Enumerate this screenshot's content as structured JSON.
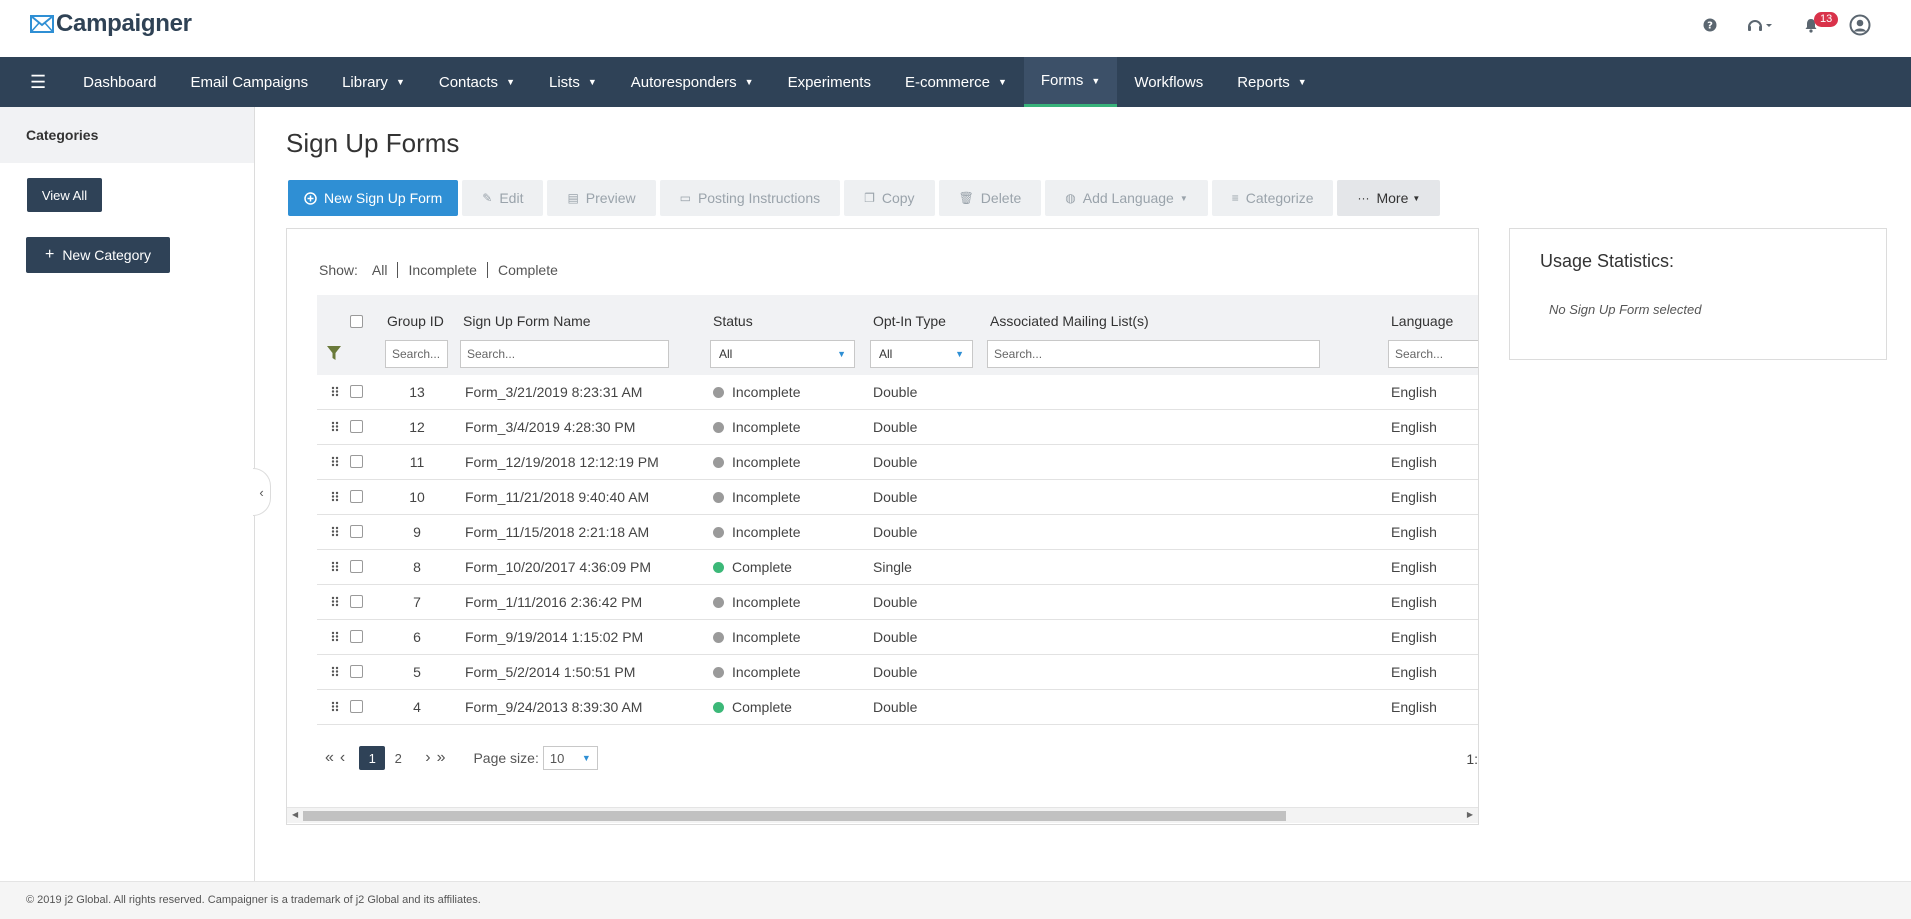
{
  "header": {
    "brand": "Campaigner",
    "notifications_count": "13"
  },
  "nav": {
    "items": [
      {
        "label": "Dashboard"
      },
      {
        "label": "Email Campaigns"
      },
      {
        "label": "Library"
      },
      {
        "label": "Contacts"
      },
      {
        "label": "Lists"
      },
      {
        "label": "Autoresponders"
      },
      {
        "label": "Experiments"
      },
      {
        "label": "E-commerce"
      },
      {
        "label": "Forms"
      },
      {
        "label": "Workflows"
      },
      {
        "label": "Reports"
      }
    ],
    "active": "Forms"
  },
  "sidebar": {
    "title": "Categories",
    "view_all": "View All",
    "new_category": "New Category"
  },
  "page": {
    "title": "Sign Up Forms"
  },
  "toolbar": {
    "new_form": "New Sign Up Form",
    "edit": "Edit",
    "preview": "Preview",
    "posting": "Posting Instructions",
    "copy": "Copy",
    "delete": "Delete",
    "add_language": "Add Language",
    "categorize": "Categorize",
    "more": "More"
  },
  "filters": {
    "show_label": "Show:",
    "all": "All",
    "incomplete": "Incomplete",
    "complete": "Complete"
  },
  "grid": {
    "columns": {
      "group_id": "Group ID",
      "name": "Sign Up Form Name",
      "status": "Status",
      "optin": "Opt-In Type",
      "lists": "Associated Mailing List(s)",
      "language": "Language"
    },
    "search_placeholder": "Search...",
    "status_filter": "All",
    "optin_filter": "All",
    "rows": [
      {
        "id": "13",
        "name": "Form_3/21/2019 8:23:31 AM",
        "status": "Incomplete",
        "optin": "Double",
        "language": "English"
      },
      {
        "id": "12",
        "name": "Form_3/4/2019 4:28:30 PM",
        "status": "Incomplete",
        "optin": "Double",
        "language": "English"
      },
      {
        "id": "11",
        "name": "Form_12/19/2018 12:12:19 PM",
        "status": "Incomplete",
        "optin": "Double",
        "language": "English"
      },
      {
        "id": "10",
        "name": "Form_11/21/2018 9:40:40 AM",
        "status": "Incomplete",
        "optin": "Double",
        "language": "English"
      },
      {
        "id": "9",
        "name": "Form_11/15/2018 2:21:18 AM",
        "status": "Incomplete",
        "optin": "Double",
        "language": "English"
      },
      {
        "id": "8",
        "name": "Form_10/20/2017 4:36:09 PM",
        "status": "Complete",
        "optin": "Single",
        "language": "English"
      },
      {
        "id": "7",
        "name": "Form_1/11/2016 2:36:42 PM",
        "status": "Incomplete",
        "optin": "Double",
        "language": "English"
      },
      {
        "id": "6",
        "name": "Form_9/19/2014 1:15:02 PM",
        "status": "Incomplete",
        "optin": "Double",
        "language": "English"
      },
      {
        "id": "5",
        "name": "Form_5/2/2014 1:50:51 PM",
        "status": "Incomplete",
        "optin": "Double",
        "language": "English"
      },
      {
        "id": "4",
        "name": "Form_9/24/2013 8:39:30 AM",
        "status": "Complete",
        "optin": "Double",
        "language": "English"
      }
    ]
  },
  "pager": {
    "pages": [
      "1",
      "2"
    ],
    "current": "1",
    "page_size_label": "Page size:",
    "page_size": "10",
    "count_partial": "1:"
  },
  "stats": {
    "title": "Usage Statistics:",
    "empty": "No Sign Up Form selected"
  },
  "footer": {
    "text": "© 2019 j2 Global. All rights reserved. Campaigner is a trademark of j2 Global and its affiliates."
  },
  "colors": {
    "nav_bg": "#2f4257",
    "primary": "#2f8fd4",
    "status_complete": "#3cb878",
    "status_incomplete": "#9a9a9a",
    "badge": "#d9324a"
  },
  "icons": [
    "logo-mark-icon",
    "help-icon",
    "headset-icon",
    "bell-icon",
    "user-icon",
    "hamburger-icon",
    "plus-circle-icon",
    "pencil-icon",
    "file-icon",
    "document-icon",
    "copy-icon",
    "trash-icon",
    "globe-icon",
    "categorize-icon",
    "ellipsis-icon",
    "filter-icon",
    "drag-handle-icon",
    "chevron-left-icon"
  ]
}
